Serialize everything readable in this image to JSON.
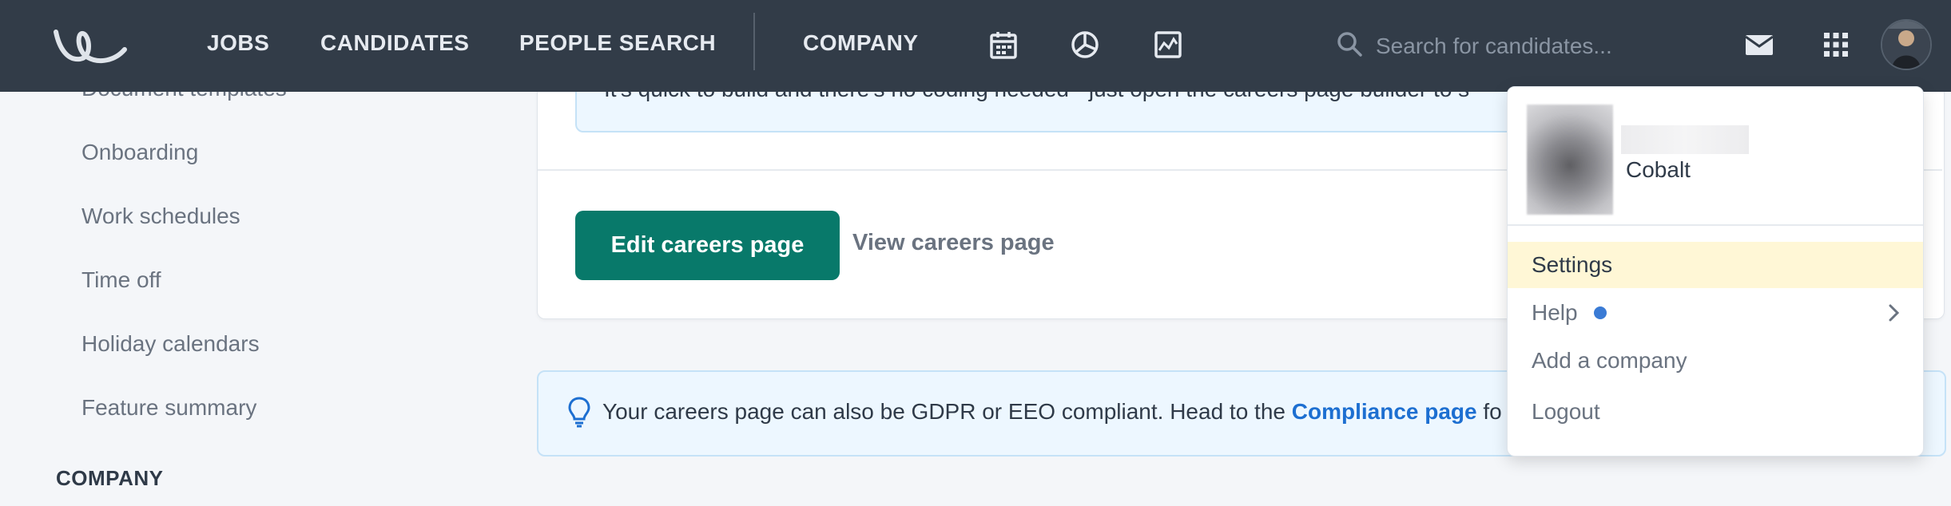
{
  "nav": {
    "links": [
      "JOBS",
      "CANDIDATES",
      "PEOPLE SEARCH",
      "COMPANY"
    ],
    "icons": [
      "calendar-icon",
      "pie-chart-icon",
      "activity-chart-icon"
    ],
    "search_placeholder": "Search for candidates..."
  },
  "sidebar": {
    "items": [
      "Document templates",
      "Onboarding",
      "Work schedules",
      "Time off",
      "Holiday calendars",
      "Feature summary"
    ],
    "section_heading": "COMPANY"
  },
  "careers_card": {
    "info_text": "It's quick to build and there's no coding needed - just open the careers page builder to s",
    "edit_button": "Edit careers page",
    "view_link": "View careers page"
  },
  "tip": {
    "text_before": "Your careers page can also be GDPR or EEO compliant. Head to the ",
    "link_text": "Compliance page",
    "text_after": " fo"
  },
  "account_menu": {
    "company": "Cobalt",
    "items": [
      "Settings",
      "Help",
      "Add a company",
      "Logout"
    ]
  },
  "colors": {
    "topbar": "#323c48",
    "primary": "#08796a",
    "link": "#1d6fd1",
    "highlight": "#fff7d6",
    "notification_dot": "#3a7bd5"
  }
}
